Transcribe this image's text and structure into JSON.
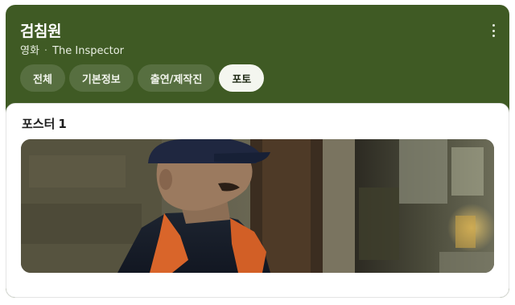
{
  "header": {
    "title": "검침원",
    "category": "영화",
    "original_title": "The Inspector",
    "separator": "·",
    "more_icon": "more-vertical-icon"
  },
  "tabs": [
    {
      "label": "전체",
      "active": false
    },
    {
      "label": "기본정보",
      "active": false
    },
    {
      "label": "출연/제작진",
      "active": false
    },
    {
      "label": "포토",
      "active": true
    }
  ],
  "section": {
    "title": "포스터",
    "count": "1"
  },
  "colors": {
    "header_bg": "#3f5a24",
    "active_tab_bg": "#f4f6ef",
    "tab_bg": "rgba(255,255,255,0.13)"
  }
}
